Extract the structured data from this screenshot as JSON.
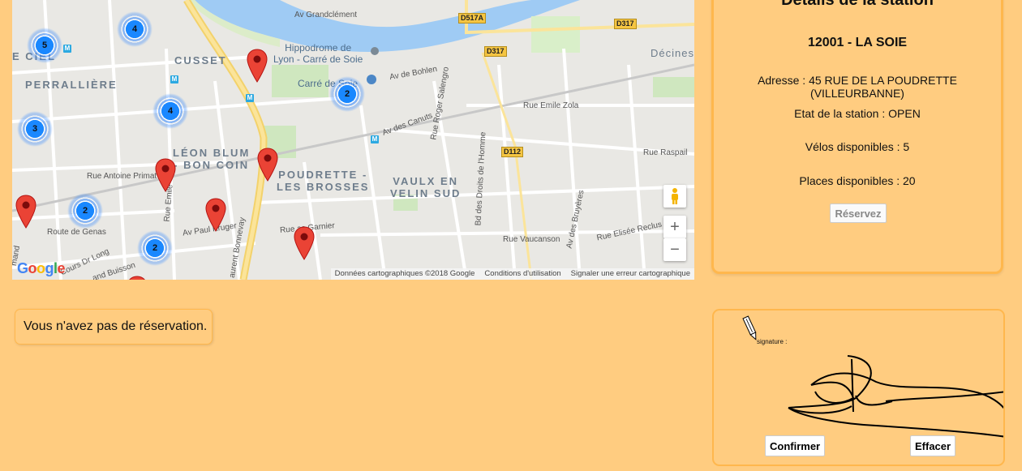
{
  "map": {
    "area_labels": [
      {
        "name": "cusset",
        "text": "CUSSET"
      },
      {
        "name": "perralliere",
        "text": "PERRALLIÈRE"
      },
      {
        "name": "ciel",
        "text": "E CIEL"
      },
      {
        "name": "leon-blum",
        "text": "LÉON BLUM\n- BON COIN"
      },
      {
        "name": "poudrette",
        "text": "POUDRETTE -\nLES BROSSES"
      },
      {
        "name": "vaulx",
        "text": "VAULX EN\nVELIN SUD"
      },
      {
        "name": "decines",
        "text": "Décines"
      }
    ],
    "poi_labels": [
      {
        "name": "hippodrome",
        "text": "Hippodrome de\nLyon - Carré de Soie"
      },
      {
        "name": "carre-de-soie",
        "text": "Carré de Soie"
      }
    ],
    "road_labels": [
      {
        "name": "av-grandclement",
        "text": "Av Grandclément"
      },
      {
        "name": "av-de-bohlen",
        "text": "Av de Bohlen"
      },
      {
        "name": "rue-roger-salengro",
        "text": "Rue Roger Salengro"
      },
      {
        "name": "rue-emile-zola",
        "text": "Rue Emile Zola"
      },
      {
        "name": "av-des-canuts",
        "text": "Av des Canuts"
      },
      {
        "name": "rue-raspail",
        "text": "Rue Raspail"
      },
      {
        "name": "rue-antoine-primat",
        "text": "Rue Antoine Primat"
      },
      {
        "name": "rue-emile",
        "text": "Rue Emile"
      },
      {
        "name": "bd-droits-homme",
        "text": "Bd des Droits de l'Homme"
      },
      {
        "name": "av-des-bruyeres",
        "text": "Av des Bruyères"
      },
      {
        "name": "route-de-genas",
        "text": "Route de Genas"
      },
      {
        "name": "av-paul-kruger",
        "text": "Av Paul Kruger"
      },
      {
        "name": "rue-garnier",
        "text": "Rue   as Garnier"
      },
      {
        "name": "rue-vaucanson",
        "text": "Rue Vaucanson"
      },
      {
        "name": "rue-elisee-reclus",
        "text": "Rue Elisée Reclus"
      },
      {
        "name": "cours-dr-long",
        "text": "Cours Dr Long"
      },
      {
        "name": "rue-buisson",
        "text": "and Buisson"
      },
      {
        "name": "laurent-bonnevay",
        "text": "aurent Bonnevay"
      },
      {
        "name": "mand",
        "text": "mand"
      }
    ],
    "shields": [
      "D517A",
      "D317",
      "D317",
      "D112"
    ],
    "clusters": [
      "4",
      "5",
      "2",
      "4",
      "3",
      "2",
      "2"
    ],
    "zoom_in": "+",
    "zoom_out": "−",
    "google_logo": "Google",
    "footer": {
      "data": "Données cartographiques ©2018 Google",
      "terms": "Conditions d'utilisation",
      "report": "Signaler une erreur cartographique"
    }
  },
  "station": {
    "panel_title": "Détails de la station",
    "name": "12001 - LA SOIE",
    "address": "Adresse : 45 RUE DE LA POUDRETTE (VILLEURBANNE)",
    "status": "Etat de la station : OPEN",
    "bikes": "Vélos disponibles : 5",
    "places": "Places disponibles : 20",
    "reserve_label": "Réservez"
  },
  "reservation": {
    "message": "Vous n'avez pas de réservation."
  },
  "signature": {
    "label": "signature :",
    "confirm_label": "Confirmer",
    "clear_label": "Effacer"
  }
}
